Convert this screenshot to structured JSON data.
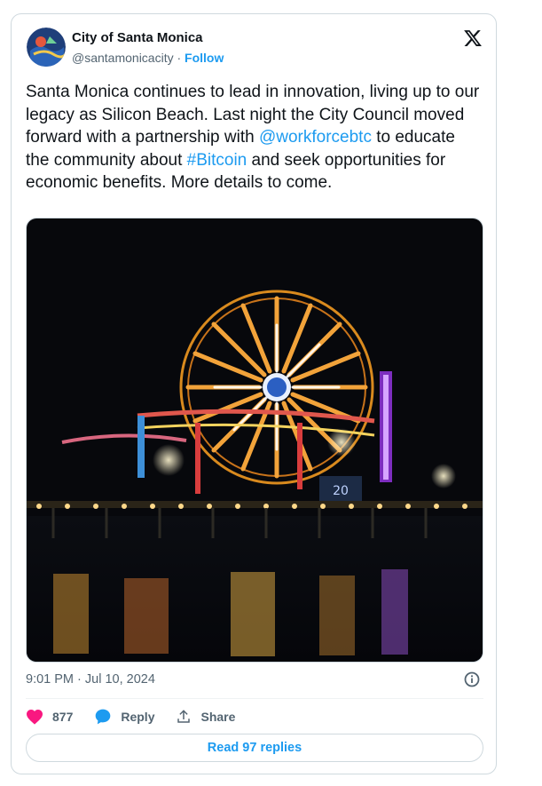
{
  "account": {
    "name": "City of Santa Monica",
    "handle": "@santamonicacity",
    "separator": "·",
    "follow_label": "Follow"
  },
  "tweet": {
    "text_before": "Santa Monica continues to lead in innovation, living up to our legacy as Silicon Beach. Last night the City Council moved forward with a partnership with ",
    "mention": "@workforcebtc",
    "text_middle": " to educate the community about ",
    "hashtag": "#Bitcoin",
    "text_after": " and seek opportunities for economic benefits. More details to come."
  },
  "media": {
    "description_icon": "santa-monica-pier-ferris-wheel-photo",
    "sign_text": "20"
  },
  "timestamp": "9:01 PM · Jul 10, 2024",
  "actions": {
    "like_count": "877",
    "reply_label": "Reply",
    "share_label": "Share"
  },
  "read_replies_label": "Read 97 replies",
  "colors": {
    "link": "#1d9bf0",
    "like": "#f91880",
    "text": "#0f1419",
    "secondary": "#536471"
  }
}
